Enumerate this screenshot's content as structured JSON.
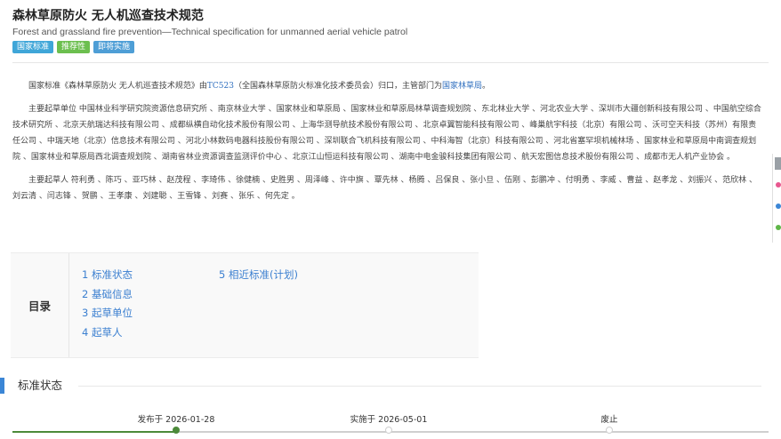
{
  "header": {
    "title": "森林草原防火 无人机巡查技术规范",
    "subtitle": "Forest and grassland fire prevention—Technical specification for unmanned aerial vehicle patrol",
    "badges": [
      "国家标准",
      "推荐性",
      "即将实施"
    ]
  },
  "content": {
    "p1_a": "国家标准《森林草原防火 无人机巡查技术规范》由",
    "p1_link1": "TC523",
    "p1_b": "（全国森林草原防火标准化技术委员会）归口，主管部门为",
    "p1_link2": "国家林草局",
    "p1_c": "。",
    "p2": "主要起草单位 中国林业科学研究院资源信息研究所 、南京林业大学 、国家林业和草原局 、国家林业和草原局林草调查规划院 、东北林业大学 、河北农业大学 、深圳市大疆创新科技有限公司 、中国航空综合技术研究所 、北京天航瑞达科技有限公司 、成都纵横自动化技术股份有限公司 、上海华测导航技术股份有限公司 、北京卓翼智能科技有限公司 、峰巢航宇科技（北京）有限公司 、沃可空天科技（苏州）有限责任公司 、中瑞天地（北京）信息技术有限公司 、河北小林数码电器科技股份有限公司 、深圳联合飞机科技有限公司 、中科海智（北京）科技有限公司 、河北省塞罕坝机械林场 、国家林业和草原局中南调查规划院 、国家林业和草原局西北调查规划院 、湖南省林业资源调查监测评价中心 、北京江山恒运科技有限公司 、湖南中电金骏科技集团有限公司 、航天宏图信息技术股份有限公司 、成都市无人机产业协会 。",
    "p3": "主要起草人 符利勇 、陈巧 、亚巧林 、赵茂程 、李琦伟 、徐健楠 、史胜男 、周泽峰 、许中旗 、覃先林 、杨腾 、吕保良 、张小旦 、伍刚 、彭鹏冲 、付明勇 、李威 、曹益 、赵孝龙 、刘振兴 、范欣林 、刘云清 、闫志锋 、贺鹏 、王孝康 、刘建聪 、王雪锋 、刘赛 、张乐 、何先定 。"
  },
  "toc": {
    "label": "目录",
    "col1": [
      "1 标准状态",
      "2 基础信息",
      "3 起草单位",
      "4 起草人"
    ],
    "col2": [
      "5 相近标准(计划)"
    ]
  },
  "section": {
    "title": "标准状态"
  },
  "timeline": {
    "events": [
      {
        "label": "发布于 2026-01-28",
        "reached": true
      },
      {
        "label": "实施于 2026-05-01",
        "reached": false
      },
      {
        "label": "废止",
        "reached": false
      }
    ],
    "colors": {
      "reached": "#4c8a3a",
      "pending": "#cfcfcf"
    }
  },
  "sidebar": {
    "icons": [
      "collapse-tab-icon",
      "pink-circle-icon",
      "blue-drop-icon",
      "green-circle-icon"
    ]
  }
}
